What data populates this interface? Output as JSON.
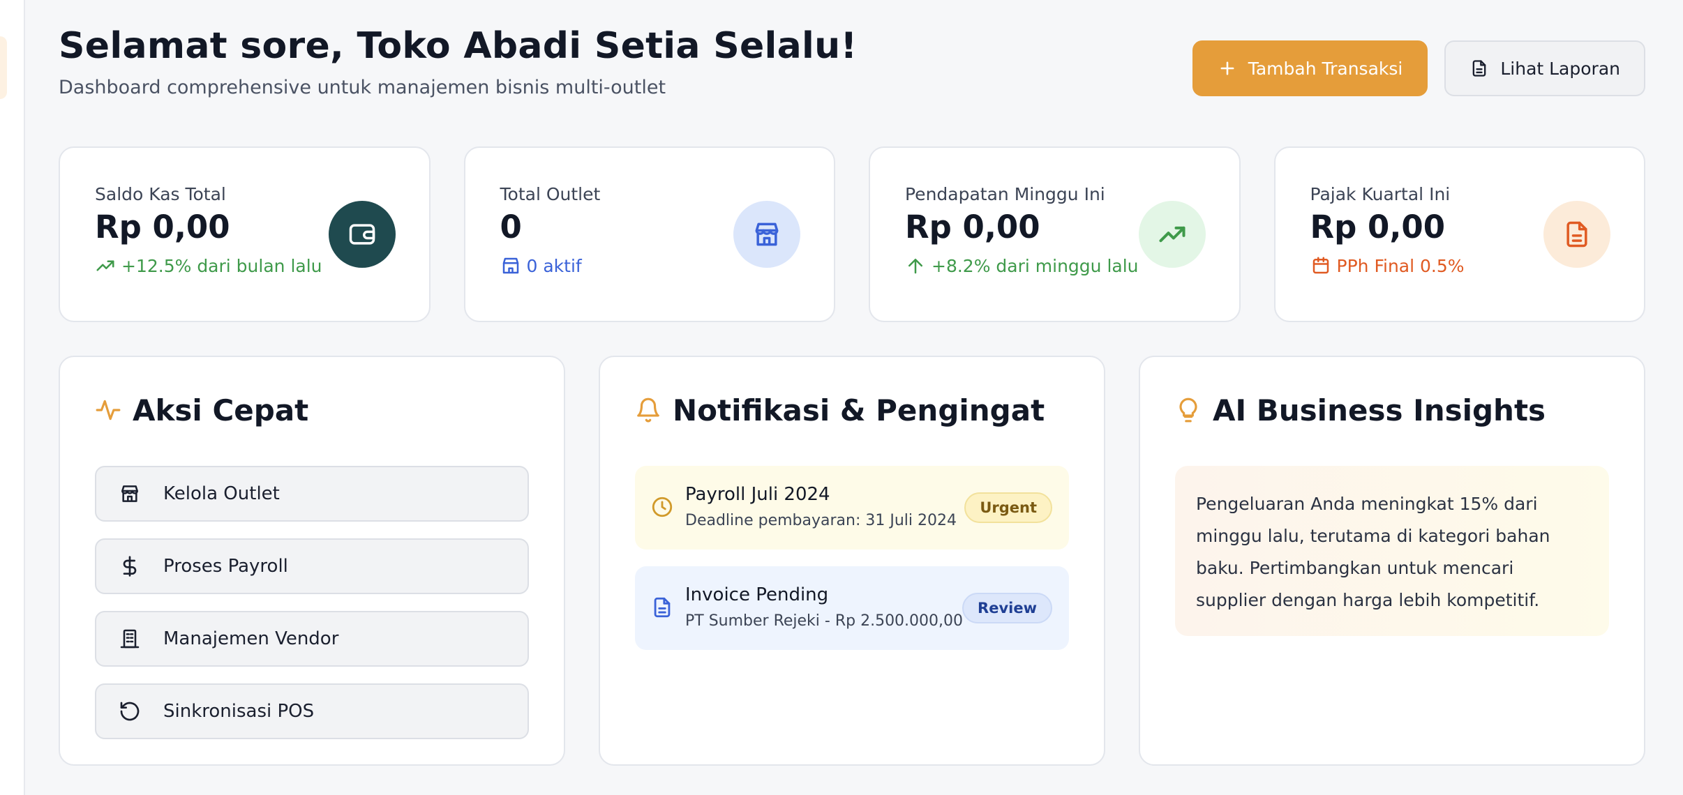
{
  "header": {
    "title": "Selamat sore, Toko Abadi Setia Selalu!",
    "subtitle": "Dashboard comprehensive untuk manajemen bisnis multi-outlet",
    "primary_button": "Tambah Transaksi",
    "secondary_button": "Lihat Laporan"
  },
  "stats": [
    {
      "label": "Saldo Kas Total",
      "value": "Rp 0,00",
      "sub": "+12.5% dari bulan lalu",
      "icon": "wallet-icon",
      "color": "#1f4a4f"
    },
    {
      "label": "Total Outlet",
      "value": "0",
      "sub": "0 aktif",
      "icon": "store-icon",
      "color": "#dbe6fb"
    },
    {
      "label": "Pendapatan Minggu Ini",
      "value": "Rp 0,00",
      "sub": "+8.2% dari minggu lalu",
      "icon": "trending-up-icon",
      "color": "#e3f6e6"
    },
    {
      "label": "Pajak Kuartal Ini",
      "value": "Rp 0,00",
      "sub": "PPh Final 0.5%",
      "icon": "document-icon",
      "color": "#fcebd9"
    }
  ],
  "quick_actions": {
    "title": "Aksi Cepat",
    "items": [
      {
        "label": "Kelola Outlet",
        "icon": "store-icon"
      },
      {
        "label": "Proses Payroll",
        "icon": "dollar-icon"
      },
      {
        "label": "Manajemen Vendor",
        "icon": "building-icon"
      },
      {
        "label": "Sinkronisasi POS",
        "icon": "refresh-icon"
      }
    ]
  },
  "notifications": {
    "title": "Notifikasi & Pengingat",
    "items": [
      {
        "title": "Payroll Juli 2024",
        "desc": "Deadline pembayaran: 31 Juli 2024",
        "badge": "Urgent",
        "icon": "clock-icon"
      },
      {
        "title": "Invoice Pending",
        "desc": "PT Sumber Rejeki - Rp 2.500.000,00",
        "badge": "Review",
        "icon": "document-icon"
      }
    ]
  },
  "insights": {
    "title": "AI Business Insights",
    "text": "Pengeluaran Anda meningkat 15% dari minggu lalu, terutama di kategori bahan baku. Pertimbangkan untuk mencari supplier dengan harga lebih kompetitif."
  },
  "colors": {
    "accent": "#e59d3a",
    "green": "#3f9a4a",
    "blue": "#3a62d8",
    "orange": "#e05a22"
  }
}
